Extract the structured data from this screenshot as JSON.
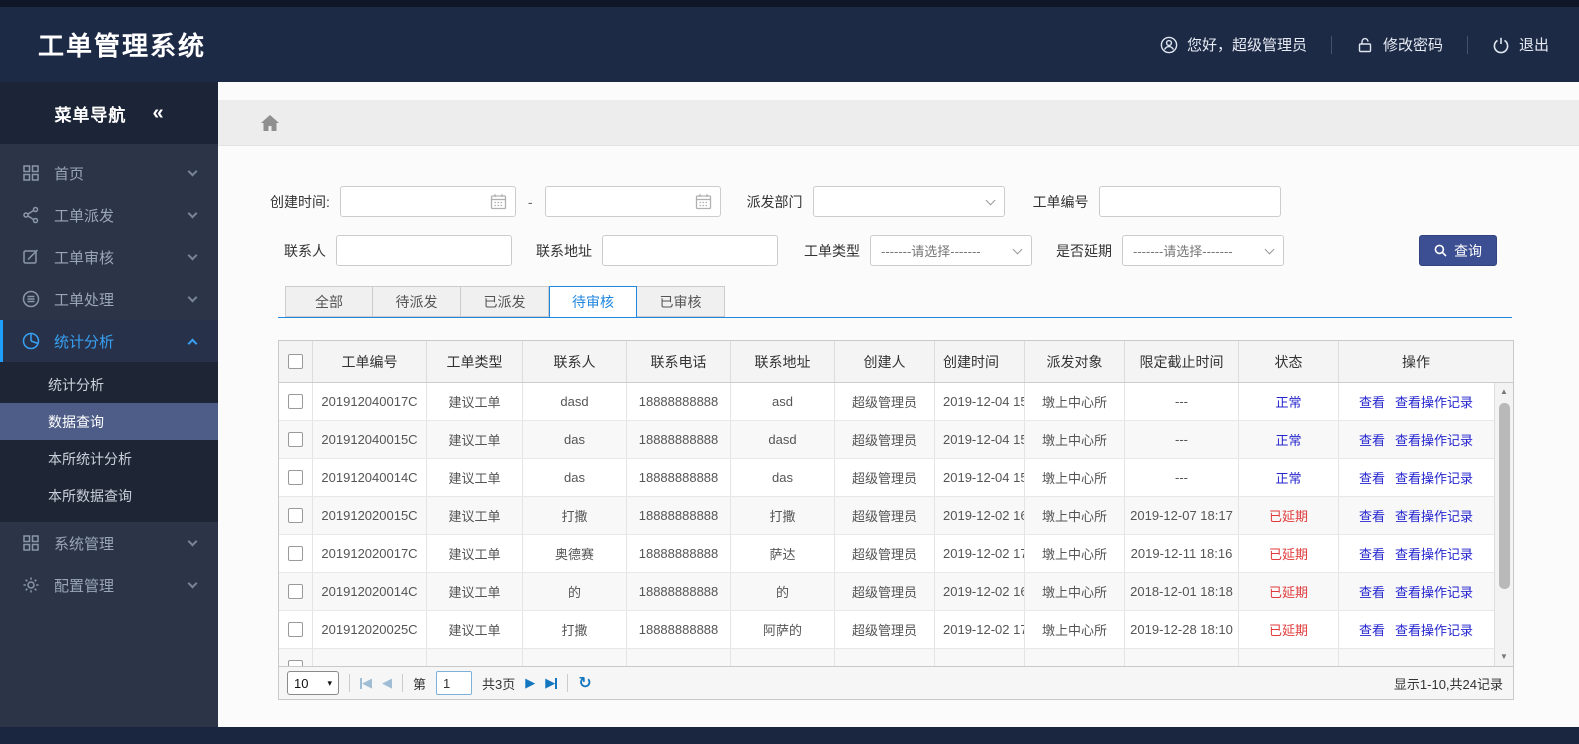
{
  "colors": {
    "header_bg": "#1d2a46",
    "sidebar_bg": "#2b3547",
    "accent_blue": "#1e9fff",
    "active_menu_text": "#38a0f2",
    "selected_submenu_bg": "#4e5d87",
    "search_button_bg": "#3c4f92",
    "tab_active_border": "#2086e0",
    "link_blue": "#2626cf",
    "status_normal_blue": "#2626cf",
    "status_delayed_red": "#e03a3a"
  },
  "header": {
    "title": "工单管理系统",
    "greeting": "您好，超级管理员",
    "change_password": "修改密码",
    "logout": "退出"
  },
  "sidebar": {
    "title": "菜单导航",
    "collapse_glyph": "«",
    "items": [
      {
        "label": "首页",
        "icon": "grid-icon"
      },
      {
        "label": "工单派发",
        "icon": "share-icon"
      },
      {
        "label": "工单审核",
        "icon": "edit-icon"
      },
      {
        "label": "工单处理",
        "icon": "process-icon"
      },
      {
        "label": "统计分析",
        "icon": "pie-chart-icon"
      },
      {
        "label": "系统管理",
        "icon": "modules-icon"
      },
      {
        "label": "配置管理",
        "icon": "gear-icon"
      }
    ],
    "submenu": [
      "统计分析",
      "数据查询",
      "本所统计分析",
      "本所数据查询"
    ],
    "selected_submenu": "数据查询"
  },
  "filters": {
    "create_time_label": "创建时间:",
    "range_separator": "-",
    "dispatch_dept_label": "派发部门",
    "order_no_label": "工单编号",
    "contact_label": "联系人",
    "address_label": "联系地址",
    "order_type_label": "工单类型",
    "order_type_value": "-------请选择-------",
    "delay_label": "是否延期",
    "delay_value": "-------请选择-------",
    "search_button": "查询"
  },
  "tabs": {
    "items": [
      "全部",
      "待派发",
      "已派发",
      "待审核",
      "已审核"
    ],
    "active": "待审核"
  },
  "table": {
    "columns": [
      "工单编号",
      "工单类型",
      "联系人",
      "联系电话",
      "联系地址",
      "创建人",
      "创建时间",
      "派发对象",
      "限定截止时间",
      "状态",
      "操作"
    ],
    "action_labels": [
      "查看",
      "查看操作记录"
    ],
    "rows": [
      {
        "order_no": "201912040017C",
        "type": "建议工单",
        "contact": "dasd",
        "phone": "18888888888",
        "address": "asd",
        "creator": "超级管理员",
        "created": "2019-12-04 15",
        "target": "墩上中心所",
        "deadline": "---",
        "status": "正常",
        "status_color": "blue"
      },
      {
        "order_no": "201912040015C",
        "type": "建议工单",
        "contact": "das",
        "phone": "18888888888",
        "address": "dasd",
        "creator": "超级管理员",
        "created": "2019-12-04 15",
        "target": "墩上中心所",
        "deadline": "---",
        "status": "正常",
        "status_color": "blue"
      },
      {
        "order_no": "201912040014C",
        "type": "建议工单",
        "contact": "das",
        "phone": "18888888888",
        "address": "das",
        "creator": "超级管理员",
        "created": "2019-12-04 15",
        "target": "墩上中心所",
        "deadline": "---",
        "status": "正常",
        "status_color": "blue"
      },
      {
        "order_no": "201912020015C",
        "type": "建议工单",
        "contact": "打撒",
        "phone": "18888888888",
        "address": "打撒",
        "creator": "超级管理员",
        "created": "2019-12-02 16",
        "target": "墩上中心所",
        "deadline": "2019-12-07 18:17",
        "status": "已延期",
        "status_color": "red"
      },
      {
        "order_no": "201912020017C",
        "type": "建议工单",
        "contact": "奥德赛",
        "phone": "18888888888",
        "address": "萨达",
        "creator": "超级管理员",
        "created": "2019-12-02 17",
        "target": "墩上中心所",
        "deadline": "2019-12-11 18:16",
        "status": "已延期",
        "status_color": "red"
      },
      {
        "order_no": "201912020014C",
        "type": "建议工单",
        "contact": "的",
        "phone": "18888888888",
        "address": "的",
        "creator": "超级管理员",
        "created": "2019-12-02 16",
        "target": "墩上中心所",
        "deadline": "2018-12-01 18:18",
        "status": "已延期",
        "status_color": "red"
      },
      {
        "order_no": "201912020025C",
        "type": "建议工单",
        "contact": "打撒",
        "phone": "18888888888",
        "address": "阿萨的",
        "creator": "超级管理员",
        "created": "2019-12-02 17",
        "target": "墩上中心所",
        "deadline": "2019-12-28 18:10",
        "status": "已延期",
        "status_color": "red"
      },
      {
        "order_no": "",
        "type": "",
        "contact": "",
        "phone": "",
        "address": "",
        "creator": "",
        "created": "",
        "target": "",
        "deadline": "",
        "status": "",
        "status_color": "blue",
        "partial": true
      }
    ]
  },
  "pagination": {
    "page_size": "10",
    "page_prefix": "第",
    "current_page": "1",
    "total_pages": "共3页",
    "summary": "显示1-10,共24记录"
  }
}
